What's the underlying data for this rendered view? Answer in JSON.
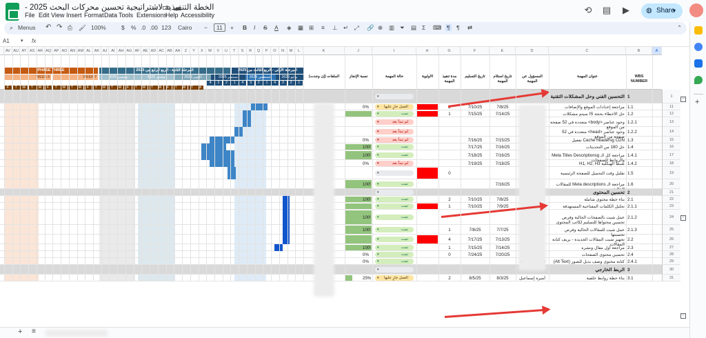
{
  "app": {
    "title": "الخطة التنفيذية لاستراتيجية تحسين محركات البحث 2025 - ",
    "menus": [
      "File",
      "Edit",
      "View",
      "Insert",
      "Format",
      "Data",
      "Tools",
      "Extensions",
      "Help",
      "Accessibility"
    ],
    "share_label": "Share"
  },
  "toolbar": {
    "menus_label": "Menus",
    "zoom": "100%",
    "currency": "$",
    "percent": "%",
    "dec_down": ".0",
    "dec_up": ".00",
    "format_num": "123",
    "font": "Cairo",
    "font_size": "11"
  },
  "formula_bar": {
    "cell_ref": "A1"
  },
  "columns_right": [
    "A",
    "B",
    "C",
    "D",
    "E",
    "F",
    "G",
    "H",
    "I",
    "J",
    "K"
  ],
  "columns_gantt": [
    "L",
    "M",
    "N",
    "O",
    "P",
    "Q",
    "R",
    "S",
    "T",
    "U",
    "V",
    "W",
    "X",
    "Y",
    "Z",
    "AA",
    "AB",
    "AC",
    "AD",
    "AE",
    "AF",
    "AG",
    "AH",
    "AI",
    "AJ",
    "AK",
    "AL",
    "AM",
    "AN",
    "AO",
    "AP",
    "AQ",
    "AR",
    "AS",
    "AT",
    "AU",
    "AV"
  ],
  "headers": {
    "wbs": "WBS NUMBER",
    "task_title": "عنوان المهمة",
    "owner": "المسؤول عن المهمة",
    "received": "تاريخ استلام المهمة",
    "delivery": "تاريخ التسليم",
    "duration": "مدة تنفيذ المهمة",
    "priority": "الأولوية",
    "status": "حالة المهمة",
    "progress": "نسبة الإنجاز",
    "files": "الملفات (إن وجدت)"
  },
  "phases": {
    "phase1": "المرحلة الأولى - الربع الثالث من 2025",
    "phase2": "المرحلة الثانية - الربع الرابع من 2025",
    "phase3": "PHASE THREE",
    "months": [
      "يوليو 2025",
      "أغسطس 2025",
      "سبتمبر 2025",
      "أكتوبر 2025",
      "نوفمبر 2025",
      "ديسمبر 2025"
    ],
    "week7": "WEEK 7",
    "week8": "WEEK 8",
    "week_nums": [
      "1",
      "2",
      "3",
      "4",
      "1",
      "2",
      "3",
      "4",
      "1",
      "2",
      "3",
      "4"
    ],
    "days": [
      "F",
      "T",
      "W",
      "T",
      "M",
      "F",
      "T",
      "W",
      "T",
      "M",
      "F",
      "T",
      "W",
      "T",
      "M",
      "F",
      "T",
      "W",
      "T",
      "M",
      "F",
      "T",
      "W",
      "T",
      "M"
    ]
  },
  "rows": [
    {
      "num": "1",
      "wbs": "1",
      "title": "التحسين الفني وحل المشكلات التقنية",
      "section": true,
      "status": "",
      "status_kind": "empty"
    },
    {
      "num": "11",
      "wbs": "1.1",
      "title": "مراجعة إعدادات الموقع والإضافات",
      "received": "7/8/25",
      "delivery": "7/10/25",
      "duration": "2",
      "priority": "high",
      "status": "العمل جارٍ عليها",
      "status_kind": "orange",
      "progress": "0%"
    },
    {
      "num": "12",
      "wbs": "1.2",
      "title": "حل الأخطاء بحجة IS سيتم مشكلات",
      "received": "7/14/25",
      "delivery": "7/15/25",
      "duration": "1",
      "priority": "high",
      "status": "تمت",
      "status_kind": "green",
      "progress": "100%"
    },
    {
      "num": "13",
      "wbs": "1.2.1",
      "title": "وجود عناصر <body> متعددة في 52 صفحة من الموقع",
      "status": "لم تبدأ بعد",
      "status_kind": "red"
    },
    {
      "num": "14",
      "wbs": "1.2.2",
      "title": "وجود عناصر <head> متعددة في 52 صفحة من الموقع",
      "status": "لم تبدأ بعد",
      "status_kind": "red"
    },
    {
      "num": "15",
      "wbs": "1.3",
      "title": "Cache headersg CDN تفعيل",
      "received": "7/15/25",
      "delivery": "7/16/25",
      "status": "لم تبدأ بعد",
      "status_kind": "red",
      "progress": "0%"
    },
    {
      "num": "16",
      "wbs": "1.4",
      "title": "حل 180 من التحديثات",
      "received": "7/16/25",
      "delivery": "7/17/25",
      "status": "تمت",
      "status_kind": "green",
      "progress": "100%"
    },
    {
      "num": "17",
      "wbs": "1.4.1",
      "title": "مراجعة كل الـ Meta Titles Descriptionsg والروابط للصفحات",
      "received": "7/16/25",
      "delivery": "7/18/25",
      "status": "تمت",
      "status_kind": "green",
      "progress": "100%"
    },
    {
      "num": "18",
      "wbs": "1.4.2",
      "title": "ضبط الهيكلية H1, H2, H3",
      "received": "7/18/25",
      "delivery": "7/19/25",
      "status": "لم تبدأ بعد",
      "status_kind": "red",
      "progress": "0%"
    },
    {
      "num": "19",
      "wbs": "1.5",
      "title": "تقليل وقت التحميل للصفحة الرئيسية",
      "duration": "0",
      "priority": "high",
      "status": "",
      "status_kind": "empty"
    },
    {
      "num": "20",
      "wbs": "1.6",
      "title": "مراجعة الـ Meta descriptions للمقالات الحالية",
      "received": "7/16/25",
      "status": "تمت",
      "status_kind": "green",
      "progress": "100%"
    },
    {
      "num": "21",
      "wbs": "2",
      "title": "تحسين المحتوى",
      "section": true,
      "status": "",
      "status_kind": "empty"
    },
    {
      "num": "22",
      "wbs": "2.1",
      "title": "بناء خطة محتوى شاملة",
      "received": "7/8/25",
      "delivery": "7/10/25",
      "duration": "2",
      "status": "تمت",
      "status_kind": "green",
      "progress": "100%"
    },
    {
      "num": "23",
      "wbs": "2.1.1",
      "title": "تحليل الكلمات المفتاحية المستهدفة",
      "received": "7/9/25",
      "delivery": "7/10/25",
      "duration": "1",
      "priority": "high",
      "status": "تمت",
      "status_kind": "green",
      "progress": "100%"
    },
    {
      "num": "24",
      "wbs": "2.1.2",
      "title": "عمل شيت بالصفحات الحالية وفرص تحسين محتواها للتسليم لكاتب المحتوى",
      "status": "تمت",
      "status_kind": "green",
      "progress": "100%"
    },
    {
      "num": "25",
      "wbs": "2.1.3",
      "title": "عمل شيت للمقالات الحالية وفرص تحسينها",
      "received": "7/7/25",
      "delivery": "7/8/25",
      "duration": "1",
      "status": "تمت",
      "status_kind": "green",
      "progress": "100%"
    },
    {
      "num": "26",
      "wbs": "2.2",
      "title": "تجهيز شيت المقالات الجديدة - بريف كتابة المقالات",
      "received": "7/13/25",
      "delivery": "7/17/25",
      "duration": "4",
      "priority": "high",
      "status": "تمت",
      "status_kind": "green",
      "progress": "100%"
    },
    {
      "num": "27",
      "wbs": "2.3",
      "title": "مراجعة أول مقال ونشره",
      "received": "7/14/25",
      "delivery": "7/15/25",
      "duration": "1",
      "status": "تمت",
      "status_kind": "green",
      "progress": "100%"
    },
    {
      "num": "28",
      "wbs": "2.4",
      "title": "تحسين محتوى الصفحات",
      "received": "7/20/25",
      "delivery": "7/24/25",
      "duration": "0",
      "status": "تمت",
      "status_kind": "green",
      "progress": "0%"
    },
    {
      "num": "29",
      "wbs": "2.4.1",
      "title": "كتابة محتوى وصف بديل للصور (Alt Text)",
      "owner": "Amira Esmail",
      "status": "تمت",
      "status_kind": "green",
      "progress": "0%"
    },
    {
      "num": "30",
      "wbs": "3",
      "title": "الربط الخارجي",
      "section": true,
      "status": "",
      "status_kind": "empty"
    },
    {
      "num": "31",
      "wbs": "3.1",
      "title": "بناء خطة روابط خلفية",
      "owner": "أميرة إسماعيل",
      "received": "8/3/25",
      "delivery": "8/5/25",
      "duration": "2",
      "status": "العمل جارٍ عليها",
      "status_kind": "orange",
      "progress": "25%"
    }
  ],
  "colors": {
    "priority_high": "#ff0000",
    "phase1": "#1f4e79",
    "phase2": "#356d8a",
    "phase3": "#c55a11",
    "gantt_bar": "#3d85c6",
    "gantt_bar_dark": "#1155cc",
    "progress_full": "#93c47d"
  },
  "icons": [
    "search-icon",
    "undo-icon",
    "redo-icon",
    "print-icon",
    "paint-format-icon",
    "bold-icon",
    "italic-icon",
    "strikethrough-icon",
    "text-color-icon",
    "fill-color-icon",
    "borders-icon",
    "merge-icon",
    "align-icon",
    "link-icon",
    "comment-icon",
    "chart-icon",
    "filter-icon",
    "function-icon",
    "history-icon",
    "comment-icon",
    "video-icon",
    "star-icon",
    "move-icon",
    "cloud-icon",
    "add-sheet-icon",
    "sheet-list-icon"
  ]
}
